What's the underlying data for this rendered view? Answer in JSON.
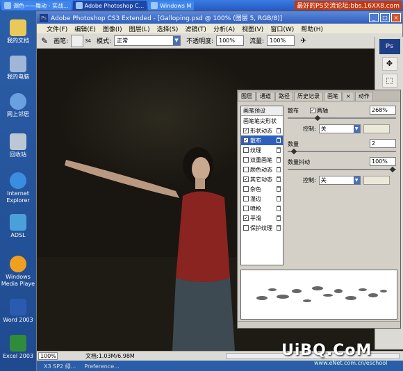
{
  "taskbar": {
    "items": [
      {
        "label": "调色——舞动 - 实战..."
      },
      {
        "label": "Adobe Photoshop C..."
      },
      {
        "label": "Windows M"
      }
    ],
    "watermark": "最好的PS交流论坛:bbs.16XX8.com"
  },
  "desktop": {
    "icons": [
      {
        "label": "我的文档"
      },
      {
        "label": "我的电脑"
      },
      {
        "label": "网上邻居"
      },
      {
        "label": "回收站"
      },
      {
        "label": "Internet Explorer"
      },
      {
        "label": "ADSL"
      },
      {
        "label": "Windows Media Playe"
      },
      {
        "label": "Word 2003"
      },
      {
        "label": "Excel 2003"
      }
    ]
  },
  "window": {
    "title": "Adobe Photoshop CS3 Extended - [Galloping.psd @ 100% (图层 5, RGB/8)]",
    "menu": [
      "文件(F)",
      "编辑(E)",
      "图像(I)",
      "图层(L)",
      "选择(S)",
      "滤镜(T)",
      "分析(A)",
      "视图(V)",
      "窗口(W)",
      "帮助(H)"
    ]
  },
  "options": {
    "brush_label": "画笔:",
    "brush_size": "34",
    "mode_label": "模式:",
    "mode_value": "正常",
    "opacity_label": "不透明度:",
    "opacity_value": "100%",
    "flow_label": "流量:",
    "flow_value": "100%"
  },
  "panel": {
    "tabs": [
      "图层",
      "通道",
      "路径",
      "历史记录",
      "画笔",
      "动作"
    ],
    "active_tab": "画笔",
    "list_header": "画笔预设",
    "list_sub": "画笔笔尖形状",
    "list": [
      {
        "label": "形状动态",
        "checked": true,
        "selected": false
      },
      {
        "label": "散布",
        "checked": true,
        "selected": true
      },
      {
        "label": "纹理",
        "checked": false,
        "selected": false
      },
      {
        "label": "双重画笔",
        "checked": false,
        "selected": false
      },
      {
        "label": "颜色动态",
        "checked": false,
        "selected": false
      },
      {
        "label": "其它动态",
        "checked": true,
        "selected": false
      },
      {
        "label": "杂色",
        "checked": false,
        "selected": false
      },
      {
        "label": "湿边",
        "checked": false,
        "selected": false
      },
      {
        "label": "喷枪",
        "checked": false,
        "selected": false
      },
      {
        "label": "平滑",
        "checked": true,
        "selected": false
      },
      {
        "label": "保护纹理",
        "checked": false,
        "selected": false
      }
    ],
    "scatter_label": "散布",
    "both_axes_label": "两轴",
    "scatter_value": "268%",
    "control_label": "控制:",
    "control_value": "关",
    "count_label": "数量",
    "count_value": "2",
    "count_jitter_label": "数量抖动",
    "count_jitter_value": "100%",
    "control2_value": "关"
  },
  "status": {
    "zoom": "100%",
    "doc": "文档:1.03M/6.98M"
  },
  "bottom": {
    "text1": "X3 SP2 绿...",
    "text2": "Preference..."
  },
  "watermark": {
    "logo": "UiBQ.CoM",
    "url": "www.eNet.com.cn/eschool"
  }
}
